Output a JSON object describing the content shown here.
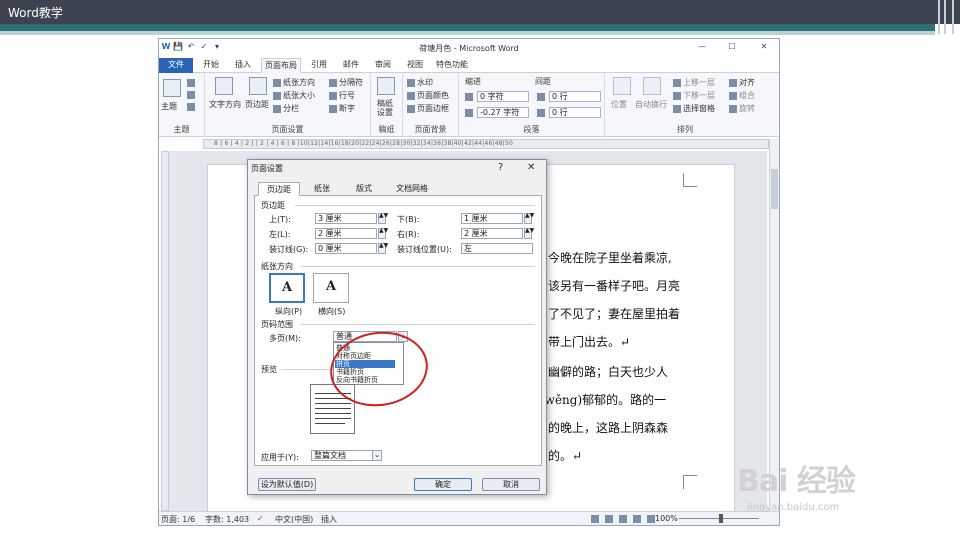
{
  "slide": {
    "title": "Word教学"
  },
  "window": {
    "title": "荷塘月色 - Microsoft Word",
    "controls": {
      "minimize": "—",
      "maximize": "☐",
      "close": "✕"
    }
  },
  "quick_access": [
    "W",
    "💾",
    "↶",
    "✓",
    "▾"
  ],
  "ribbon_tabs": [
    {
      "label": "文件",
      "kind": "file"
    },
    {
      "label": "开始"
    },
    {
      "label": "插入"
    },
    {
      "label": "页面布局",
      "active": true
    },
    {
      "label": "引用"
    },
    {
      "label": "邮件"
    },
    {
      "label": "审阅"
    },
    {
      "label": "视图"
    },
    {
      "label": "特色功能"
    }
  ],
  "ribbon": {
    "themes": {
      "label": "主题",
      "group": "主题"
    },
    "page_setup": {
      "group": "页面设置",
      "text_direction": "文字方向",
      "margins": "页边距",
      "orientation": "纸张方向",
      "size": "纸张大小",
      "columns": "分栏",
      "breaks": "分隔符",
      "line_numbers": "行号",
      "hyphenation": "断字"
    },
    "manuscript": {
      "label": "稿纸设置",
      "group": "稿纸"
    },
    "page_background": {
      "group": "页面背景",
      "watermark": "水印",
      "page_color": "页面颜色",
      "page_borders": "页面边框"
    },
    "paragraph": {
      "group": "段落",
      "indent": "缩进",
      "spacing": "间距",
      "indent_left": "0 字符",
      "indent_right": "-0.27 字符",
      "spacing_before": "0 行",
      "spacing_after": "0 行"
    },
    "arrange": {
      "group": "排列",
      "position": "位置",
      "wrap": "自动换行",
      "bring_forward": "上移一层",
      "send_backward": "下移一层",
      "selection_pane": "选择窗格",
      "align": "对齐",
      "group_btn": "组合",
      "rotate": "旋转"
    }
  },
  "ruler_text": "8 | 6 | 4 | 2 | | 2 | 4 | 6 | 8 |10|12|14|16|18|20|22|24|26|28|30|32|34|36|38|40|42|44|46|48|50",
  "doc_lines": [
    "今晚在院子里坐着乘凉,",
    "该另有一番样子吧。月亮",
    "了不见了；妻在屋里拍着",
    "带上门出去。↵",
    "幽僻的路；白天也少人",
    "(wěng)郁郁的。路的一",
    "的晚上，这路上阴森森",
    "的。↵"
  ],
  "status": {
    "page": "页面: 1/6",
    "words": "字数: 1,403",
    "language": "中文(中国)",
    "mode": "插入",
    "zoom": "100%"
  },
  "dialog": {
    "title": "页面设置",
    "help": "?",
    "close": "✕",
    "tabs": [
      {
        "label": "页边距",
        "active": true
      },
      {
        "label": "纸张"
      },
      {
        "label": "版式"
      },
      {
        "label": "文档网格"
      }
    ],
    "margins_section": "页边距",
    "top_label": "上(T):",
    "top_value": "3 厘米",
    "bottom_label": "下(B):",
    "bottom_value": "1 厘米",
    "left_label": "左(L):",
    "left_value": "2 厘米",
    "right_label": "右(R):",
    "right_value": "2 厘米",
    "gutter_label": "装订线(G):",
    "gutter_value": "0 厘米",
    "gutter_pos_label": "装订线位置(U):",
    "gutter_pos_value": "左",
    "orientation_section": "纸张方向",
    "portrait": "纵向(P)",
    "landscape": "横向(S)",
    "pages_section": "页码范围",
    "multiple_label": "多页(M):",
    "multiple_value": "普通",
    "dropdown_options": [
      "普通",
      "对称页边距",
      "拼页",
      "书籍折页",
      "反向书籍折页"
    ],
    "dropdown_selected_index": 2,
    "preview_section": "预览",
    "apply_label": "应用于(Y):",
    "apply_value": "整篇文档",
    "default_btn": "设为默认值(D)",
    "ok_btn": "确定",
    "cancel_btn": "取消"
  },
  "watermark": {
    "logo": "Bai 经验",
    "sub": "jingyan.baidu.com"
  }
}
